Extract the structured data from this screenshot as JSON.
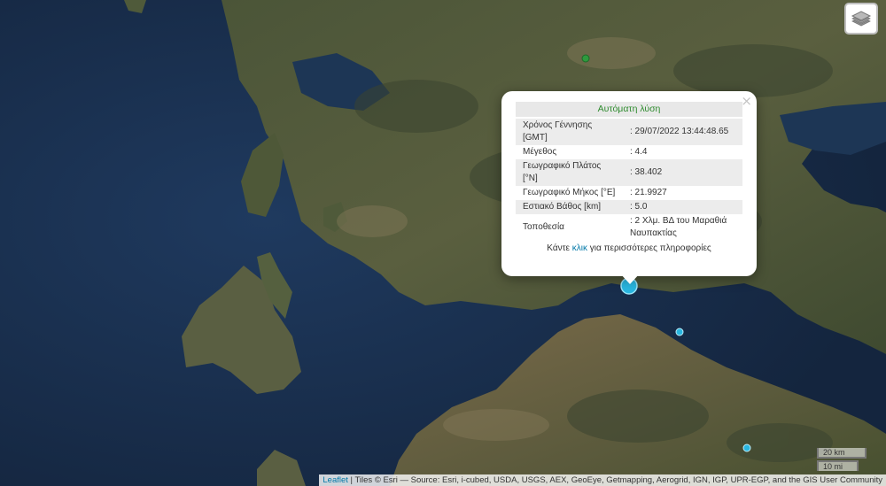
{
  "map": {
    "basemap": "satellite-imagery",
    "colors": {
      "sea": "#1b3050",
      "land": "#4d5a3a",
      "marker": "#29b6e0"
    }
  },
  "controls": {
    "layers_icon": "layers-icon"
  },
  "popup": {
    "title": "Αυτόματη λύση",
    "close": "×",
    "rows": [
      {
        "label": "Χρόνος Γέννησης [GMT]",
        "value": ": 29/07/2022 13:44:48.65"
      },
      {
        "label": "Μέγεθος",
        "value": ": 4.4"
      },
      {
        "label": "Γεωγραφικό Πλάτος [°N]",
        "value": ": 38.402"
      },
      {
        "label": "Γεωγραφικό Μήκος [°E]",
        "value": ": 21.9927"
      },
      {
        "label": "Εστιακό Βάθος [km]",
        "value": ": 5.0"
      },
      {
        "label": "Τοποθεσία",
        "value": ": 2 Χλμ. ΒΔ του Μαραθιά Ναυπακτίας"
      }
    ],
    "more_prefix": "Κάντε ",
    "more_link": "κλικ",
    "more_suffix": " για περισσότερες πληροφορίες"
  },
  "scale": {
    "km": "20 km",
    "mi": "10 mi"
  },
  "attribution": {
    "leaflet": "Leaflet",
    "text": " | Tiles © Esri — Source: Esri, i-cubed, USDA, USGS, AEX, GeoEye, Getmapping, Aerogrid, IGN, IGP, UPR-EGP, and the GIS User Community"
  }
}
